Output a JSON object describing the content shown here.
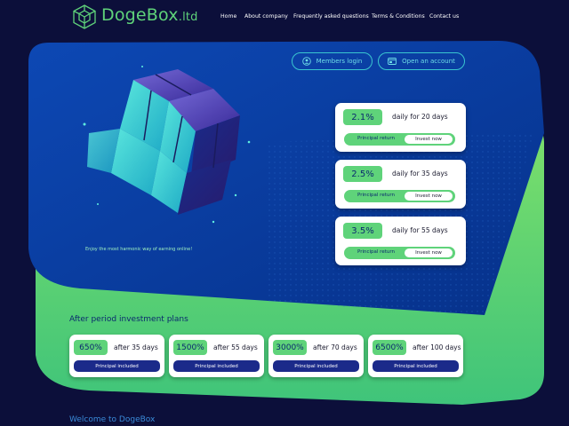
{
  "brand": {
    "name": "DogeBox",
    "suffix": ".ltd"
  },
  "nav": [
    "Home",
    "About company",
    "Frequently asked questions",
    "Terms & Conditions",
    "Contact us"
  ],
  "buttons": {
    "members_login": "Members login",
    "open_account": "Open an account"
  },
  "tagline": "Enjoy the most harmonic way of earning online!",
  "daily_plans": [
    {
      "rate": "2.1%",
      "period": "daily for 20 days",
      "principal": "Principal return",
      "invest": "Invest now"
    },
    {
      "rate": "2.5%",
      "period": "daily for 35 days",
      "principal": "Principal return",
      "invest": "Invest now"
    },
    {
      "rate": "3.5%",
      "period": "daily for 55 days",
      "principal": "Principal return",
      "invest": "Invest now"
    }
  ],
  "after_section_title": "After period investment plans",
  "after_plans": [
    {
      "pct": "650%",
      "after": "after 35 days",
      "principal": "Principal included"
    },
    {
      "pct": "1500%",
      "after": "after 55 days",
      "principal": "Principal included"
    },
    {
      "pct": "3000%",
      "after": "after 70 days",
      "principal": "Principal included"
    },
    {
      "pct": "6500%",
      "after": "after 100 days",
      "principal": "Principal included"
    }
  ],
  "welcome": "Welcome to DogeBox",
  "colors": {
    "bg": "#0c0f3a",
    "blue_panel": "#0a3a9a",
    "green": "#5fd37a",
    "accent_cyan": "#39c6d0"
  }
}
